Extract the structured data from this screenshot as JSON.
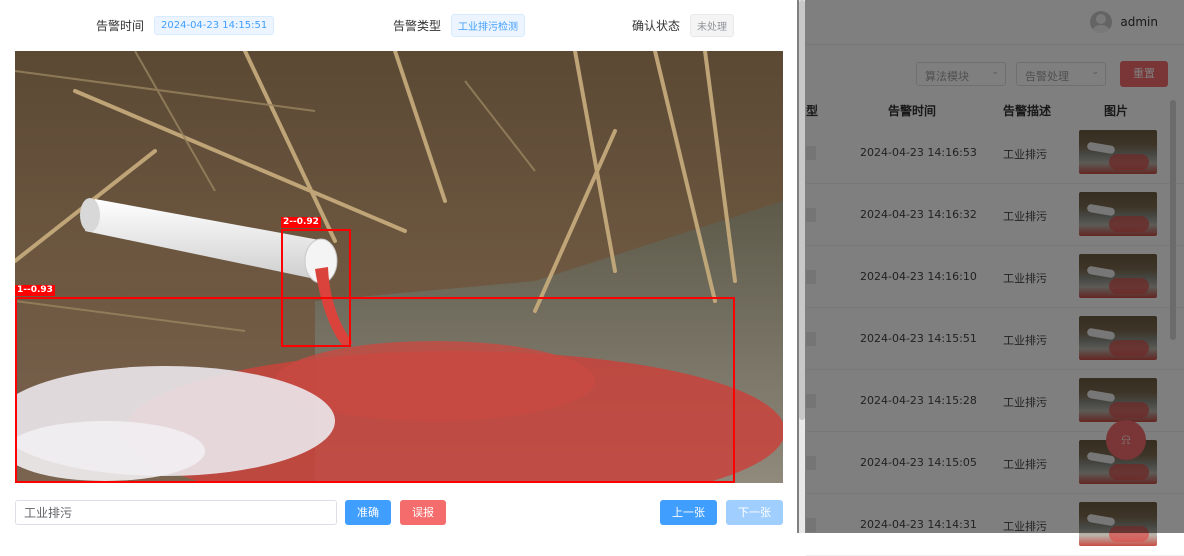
{
  "background": {
    "user": {
      "name": "admin",
      "avatar_icon": "user-avatar-icon"
    },
    "filters": {
      "algo_module": "算法模块",
      "alarm_handle": "告警处理",
      "reset_label": "重置"
    },
    "table": {
      "headers": {
        "type": "型",
        "time": "告警时间",
        "desc": "告警描述",
        "image": "图片"
      },
      "rows": [
        {
          "time": "2024-04-23 14:16:53",
          "desc": "工业排污"
        },
        {
          "time": "2024-04-23 14:16:32",
          "desc": "工业排污"
        },
        {
          "time": "2024-04-23 14:16:10",
          "desc": "工业排污"
        },
        {
          "time": "2024-04-23 14:15:51",
          "desc": "工业排污"
        },
        {
          "time": "2024-04-23 14:15:28",
          "desc": "工业排污"
        },
        {
          "time": "2024-04-23 14:15:05",
          "desc": "工业排污"
        },
        {
          "time": "2024-04-23 14:14:31",
          "desc": "工业排污"
        }
      ]
    }
  },
  "dialog": {
    "info": {
      "time_label": "告警时间",
      "time_value": "2024-04-23 14:15:51",
      "type_label": "告警类型",
      "type_value": "工业排污检测",
      "status_label": "确认状态",
      "status_value": "未处理"
    },
    "detections": [
      {
        "label": "1--0.93"
      },
      {
        "label": "2--0.92"
      }
    ],
    "footer": {
      "input_value": "工业排污",
      "correct_label": "准确",
      "false_label": "误报",
      "prev_label": "上一张",
      "next_label": "下一张"
    }
  },
  "colors": {
    "primary": "#409eff",
    "danger": "#f56c6c",
    "box": "#ff0000"
  }
}
